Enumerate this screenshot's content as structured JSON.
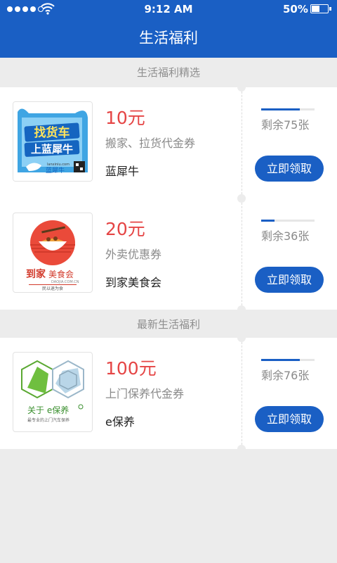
{
  "status_bar": {
    "time": "9:12 AM",
    "battery": "50%",
    "battery_level": 0.5,
    "signal_bars": 4
  },
  "navbar": {
    "title": "生活福利"
  },
  "sections": [
    {
      "title": "生活福利精选"
    },
    {
      "title": "最新生活福利"
    }
  ],
  "coupons": [
    {
      "amount": "10元",
      "description": "搬家、拉货代金券",
      "merchant": "蓝犀牛",
      "remaining": "剩余75张",
      "remaining_ratio": 0.72,
      "button": "立即领取",
      "logo_icon": "lanxiniu-logo",
      "logo_text": {
        "line1": "找货车",
        "line2": "上蓝犀牛",
        "url": "lanxiniu.com",
        "brand": "蓝犀牛"
      }
    },
    {
      "amount": "20元",
      "description": "外卖优惠券",
      "merchant": "到家美食会",
      "remaining": "剩余36张",
      "remaining_ratio": 0.25,
      "button": "立即领取",
      "logo_icon": "daojia-logo",
      "logo_text": {
        "brand_a": "到家",
        "brand_b": "美食会",
        "url": "DAOJIA.COM.CN",
        "slogan": "民以退为食"
      }
    },
    {
      "amount": "100元",
      "description": "上门保养代金券",
      "merchant": "e保养",
      "remaining": "剩余76张",
      "remaining_ratio": 0.72,
      "button": "立即领取",
      "logo_icon": "ebaoyang-logo",
      "logo_text": {
        "about": "关于 e保养",
        "tagline": "最专业的上门汽车保养"
      }
    }
  ],
  "colors": {
    "brand_blue": "#1a5fc4",
    "price_red": "#e54545",
    "background": "#ececec"
  }
}
